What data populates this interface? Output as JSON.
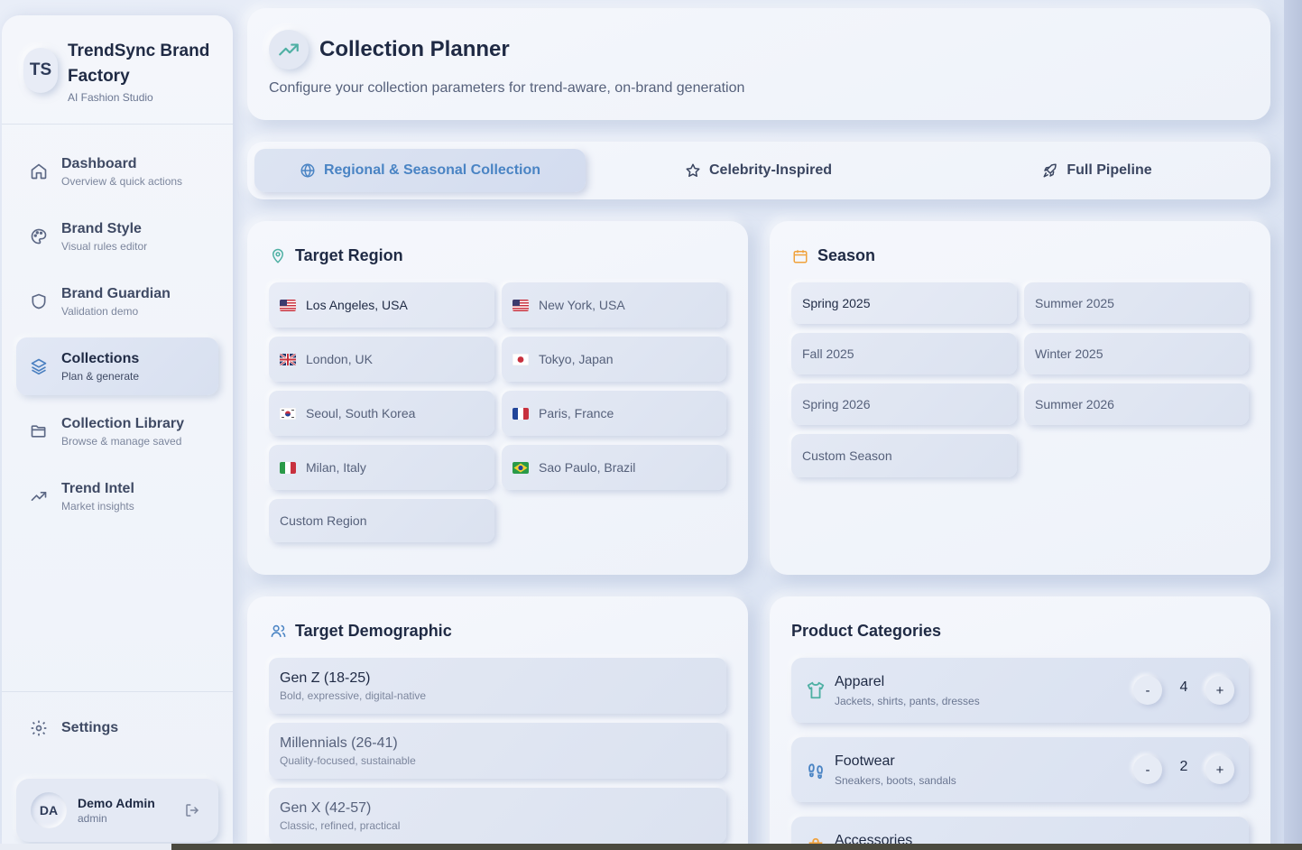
{
  "brand": {
    "initials": "TS",
    "name": "TrendSync Brand Factory",
    "subtitle": "AI Fashion Studio"
  },
  "nav": [
    {
      "title": "Dashboard",
      "subtitle": "Overview & quick actions",
      "icon": "home-icon"
    },
    {
      "title": "Brand Style",
      "subtitle": "Visual rules editor",
      "icon": "palette-icon"
    },
    {
      "title": "Brand Guardian",
      "subtitle": "Validation demo",
      "icon": "shield-icon"
    },
    {
      "title": "Collections",
      "subtitle": "Plan & generate",
      "icon": "layers-icon",
      "active": true
    },
    {
      "title": "Collection Library",
      "subtitle": "Browse & manage saved",
      "icon": "folder-icon"
    },
    {
      "title": "Trend Intel",
      "subtitle": "Market insights",
      "icon": "trending-up-icon"
    }
  ],
  "settings_label": "Settings",
  "user": {
    "initials": "DA",
    "name": "Demo Admin",
    "role": "admin"
  },
  "header": {
    "title": "Collection Planner",
    "subtitle": "Configure your collection parameters for trend-aware, on-brand generation"
  },
  "tabs": [
    {
      "label": "Regional & Seasonal Collection",
      "active": true
    },
    {
      "label": "Celebrity-Inspired"
    },
    {
      "label": "Full Pipeline"
    }
  ],
  "region": {
    "title": "Target Region",
    "options": [
      {
        "label": "Los Angeles, USA",
        "flag": "us",
        "selected": true
      },
      {
        "label": "New York, USA",
        "flag": "us"
      },
      {
        "label": "London, UK",
        "flag": "gb"
      },
      {
        "label": "Tokyo, Japan",
        "flag": "jp"
      },
      {
        "label": "Seoul, South Korea",
        "flag": "kr"
      },
      {
        "label": "Paris, France",
        "flag": "fr"
      },
      {
        "label": "Milan, Italy",
        "flag": "it"
      },
      {
        "label": "Sao Paulo, Brazil",
        "flag": "br"
      }
    ],
    "custom": "Custom Region"
  },
  "season": {
    "title": "Season",
    "options": [
      {
        "label": "Spring 2025",
        "selected": true
      },
      {
        "label": "Summer 2025"
      },
      {
        "label": "Fall 2025"
      },
      {
        "label": "Winter 2025"
      },
      {
        "label": "Spring 2026"
      },
      {
        "label": "Summer 2026"
      },
      {
        "label": "Custom Season"
      }
    ]
  },
  "demographic": {
    "title": "Target Demographic",
    "options": [
      {
        "title": "Gen Z (18-25)",
        "subtitle": "Bold, expressive, digital-native",
        "selected": true
      },
      {
        "title": "Millennials (26-41)",
        "subtitle": "Quality-focused, sustainable"
      },
      {
        "title": "Gen X (42-57)",
        "subtitle": "Classic, refined, practical"
      }
    ]
  },
  "products": {
    "title": "Product Categories",
    "items": [
      {
        "title": "Apparel",
        "subtitle": "Jackets, shirts, pants, dresses",
        "count": "4"
      },
      {
        "title": "Footwear",
        "subtitle": "Sneakers, boots, sandals",
        "count": "2"
      },
      {
        "title": "Accessories",
        "subtitle": "",
        "count": ""
      }
    ],
    "minus": "-",
    "plus": "+"
  },
  "colors": {
    "accent": "#4a84c4",
    "teal": "#4fb0a4",
    "orange": "#f0a23c"
  }
}
